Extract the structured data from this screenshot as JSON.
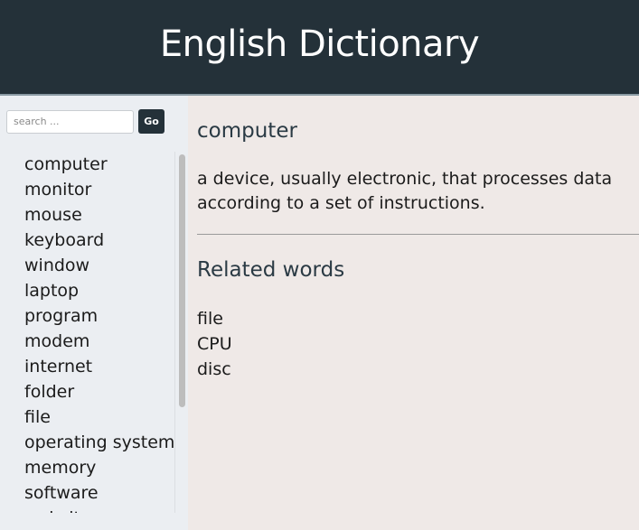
{
  "header": {
    "title": "English Dictionary"
  },
  "search": {
    "placeholder": "search ...",
    "value": "",
    "button_label": "Go"
  },
  "sidebar": {
    "words": [
      "computer",
      "monitor",
      "mouse",
      "keyboard",
      "window",
      "laptop",
      "program",
      "modem",
      "internet",
      "folder",
      "file",
      "operating system",
      "memory",
      "software",
      "website"
    ]
  },
  "entry": {
    "word": "computer",
    "definition": "a device, usually electronic, that processes data according to a set of instructions.",
    "related_heading": "Related words",
    "related": [
      "file",
      "CPU",
      "disc"
    ]
  },
  "colors": {
    "header_bg": "#243139",
    "sidebar_bg": "#ebeef2",
    "content_bg": "#efe9e7",
    "button_bg": "#243139"
  }
}
